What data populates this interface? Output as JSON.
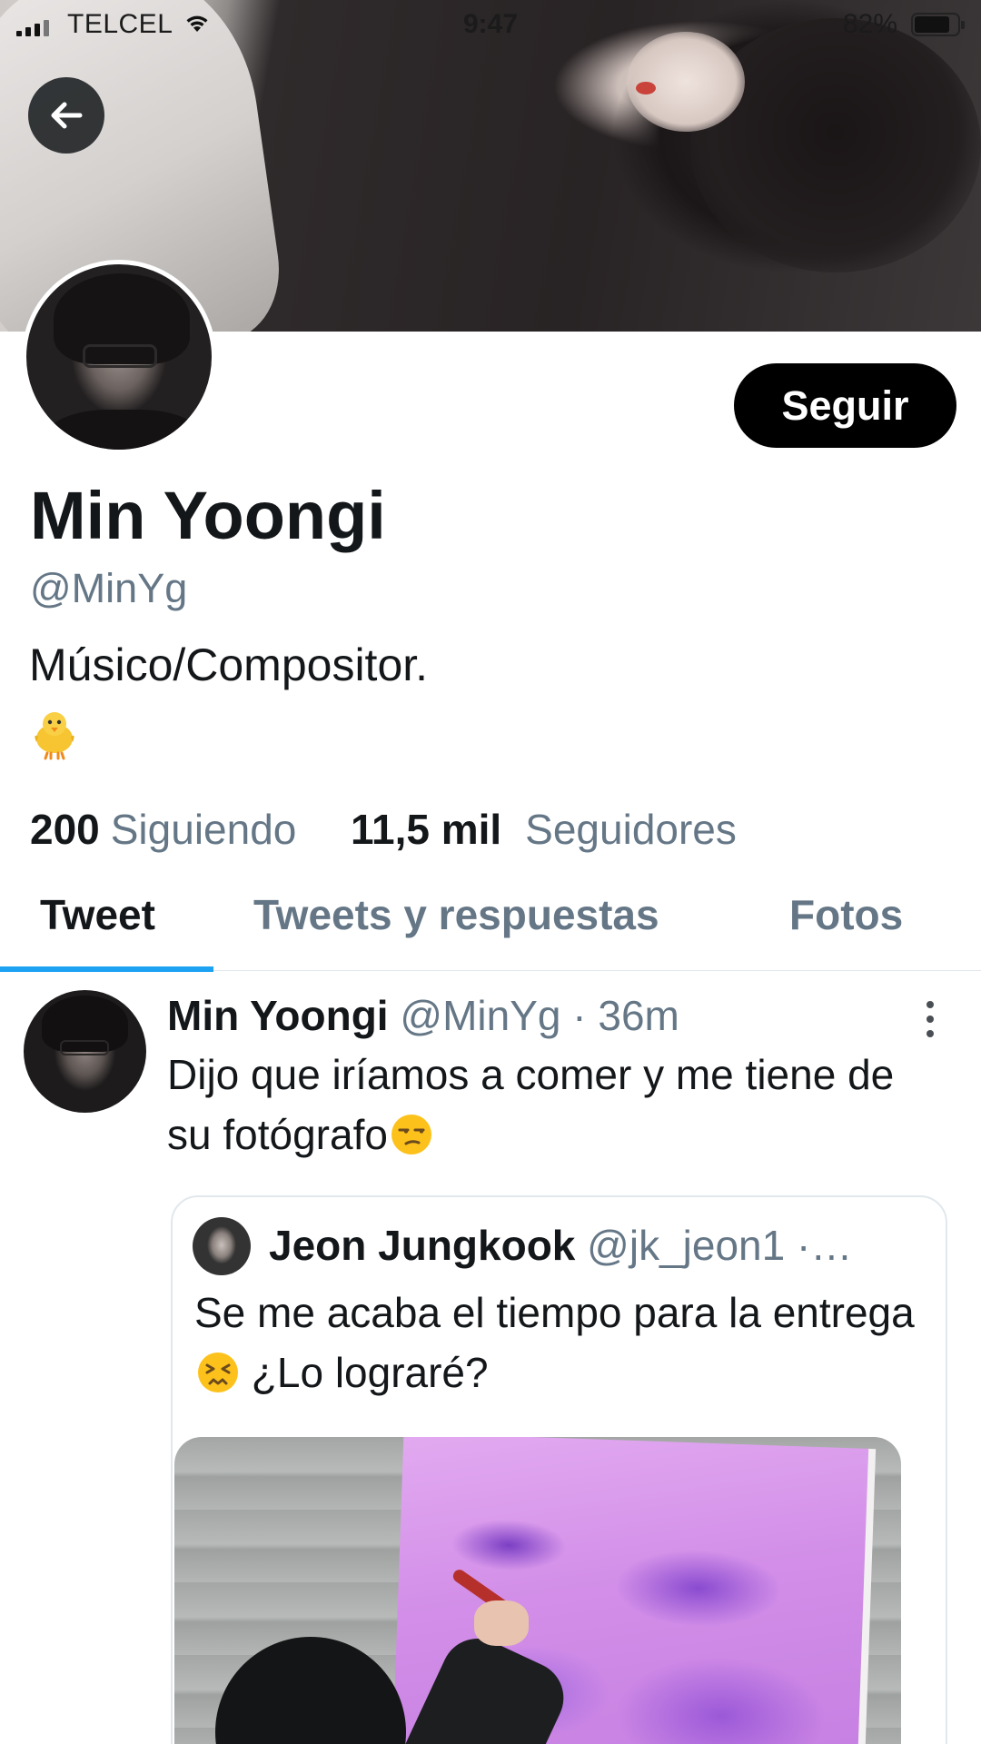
{
  "status_bar": {
    "carrier": "TELCEL",
    "time": "9:47",
    "battery_percent": "82%",
    "battery_level": 0.82
  },
  "profile": {
    "display_name": "Min Yoongi",
    "handle": "@MinYg",
    "bio": "Músico/Compositor.",
    "bio_emoji": "baby-chick-icon",
    "follow_label": "Seguir",
    "following_count": "200",
    "following_label": "Siguiendo",
    "followers_count": "11,5 mil",
    "followers_label": "Seguidores"
  },
  "tabs": [
    {
      "label": "Tweet",
      "active": true
    },
    {
      "label": "Tweets y respuestas",
      "active": false
    },
    {
      "label": "Fotos",
      "active": false
    }
  ],
  "tweet": {
    "author_name": "Min Yoongi",
    "author_handle": "@MinYg",
    "separator": "·",
    "time": "36m",
    "text": "Dijo que iríamos a comer y me tiene de su fotógrafo",
    "text_emoji": "unamused-face-icon",
    "quoted": {
      "author_name": "Jeon Jungkook",
      "author_handle": "@jk_jeon1",
      "separator": "·…",
      "text_part1": "Se me acaba el tiempo para la entrega",
      "text_emoji": "persevering-face-icon",
      "text_part2": " ¿Lo lograré?"
    }
  },
  "colors": {
    "accent": "#1da1f2",
    "secondary_text": "#657786",
    "primary_text": "#14171a",
    "follow_button_bg": "#000000"
  }
}
